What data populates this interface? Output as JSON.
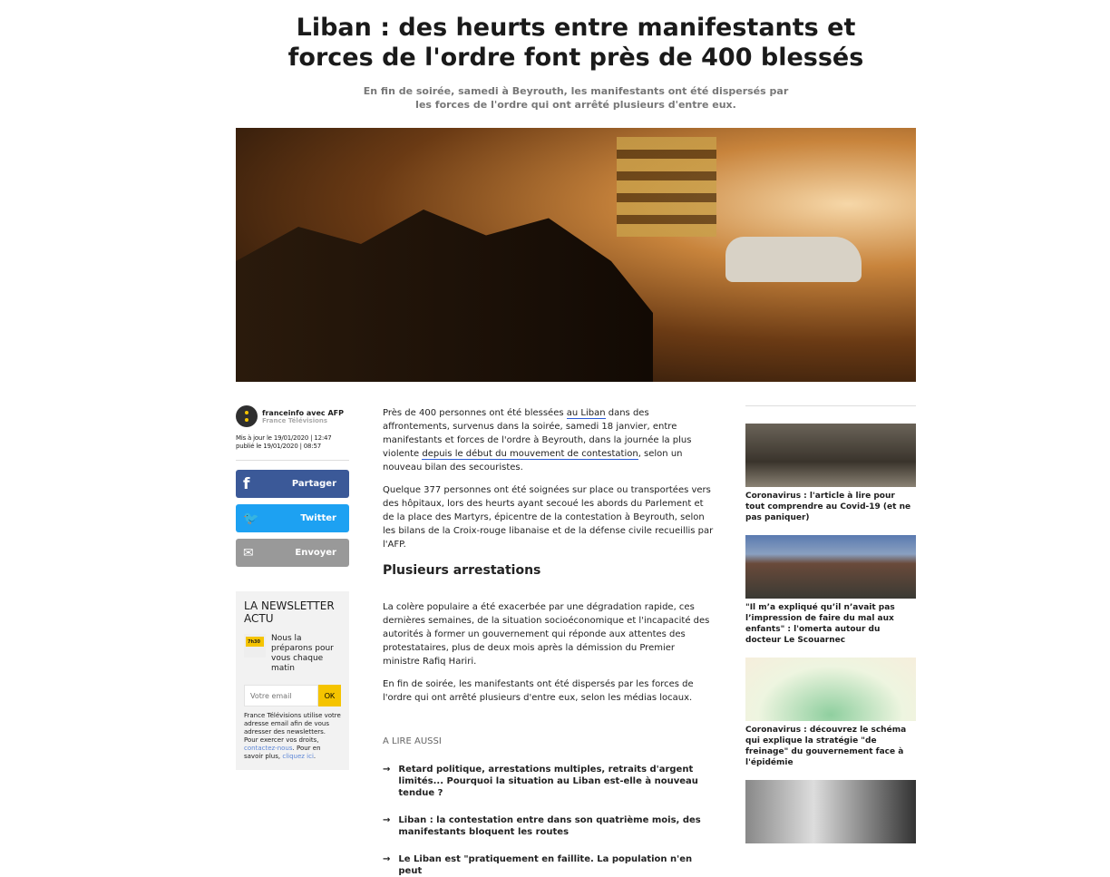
{
  "article": {
    "title": "Liban : des heurts entre manifestants et forces de l'ordre font près de 400 blessés",
    "subtitle": "En fin de soirée, samedi à Beyrouth, les manifestants ont été dispersés par les forces de l'ordre qui ont arrêté plusieurs d'entre eux.",
    "p1a": "Près de 400 personnes ont été blessées ",
    "p1link1": "au Liban",
    "p1b": " dans des affrontements, survenus dans la soirée, samedi 18 janvier, entre manifestants et forces de l'ordre à Beyrouth, dans la journée la plus violente ",
    "p1link2": "depuis le début du mouvement de contestation",
    "p1c": ", selon un nouveau bilan des secouristes.",
    "p2": "Quelque 377 personnes ont été soignées sur place ou transportées vers des hôpitaux, lors des heurts ayant secoué les abords du Parlement et de la place des Martyrs, épicentre de la contestation à Beyrouth, selon les bilans de la Croix-rouge libanaise et de la défense civile recueillis par l'AFP.",
    "h2": "Plusieurs arrestations",
    "p3": "La colère populaire a été exacerbée par une dégradation rapide, ces dernières semaines, de la situation socioéconomique et l'incapacité des autorités à former un gouvernement qui réponde aux attentes des protestataires, plus de deux mois après la démission du Premier ministre Rafiq Hariri.",
    "p4": "En fin de soirée, les manifestants ont été dispersés par les forces de l'ordre qui ont arrêté plusieurs d'entre eux, selon les médias locaux.",
    "lire_label": "A LIRE AUSSI",
    "related": [
      "Retard politique, arrestations multiples, retraits d'argent limités... Pourquoi la situation au Liban est-elle à nouveau tendue ?",
      "Liban : la contestation entre dans son quatrième mois, des manifestants bloquent les routes",
      "Le Liban est \"pratiquement en faillite. La population n'en peut"
    ]
  },
  "author": {
    "name": "franceinfo avec AFP",
    "org": "France Télévisions",
    "updated": "Mis à jour le 19/01/2020 | 12:47",
    "published": "publié le 19/01/2020 | 08:57"
  },
  "share": {
    "facebook": "Partager",
    "twitter": "Twitter",
    "email": "Envoyer"
  },
  "newsletter": {
    "title": "LA NEWSLETTER ACTU",
    "icon_text": "7h30",
    "text": "Nous la préparons pour vous chaque matin",
    "placeholder": "Votre email",
    "button": "OK",
    "legal_a": "France Télévisions utilise votre adresse email afin de vous adresser des newsletters. Pour exercer vos droits, ",
    "legal_link1": "contactez-nous",
    "legal_b": ". Pour en savoir plus, ",
    "legal_link2": "cliquez ici",
    "legal_c": "."
  },
  "sidebar": [
    {
      "title": "Coronavirus : l'article à lire pour tout comprendre au Covid-19 (et ne pas paniquer)"
    },
    {
      "title": "\"Il m’a expliqué qu’il n’avait pas l’impression de faire du mal aux enfants\" : l'omerta autour du docteur Le Scouarnec"
    },
    {
      "title": "Coronavirus : découvrez le schéma qui explique la stratégie \"de freinage\" du gouvernement face à l'épidémie"
    }
  ]
}
